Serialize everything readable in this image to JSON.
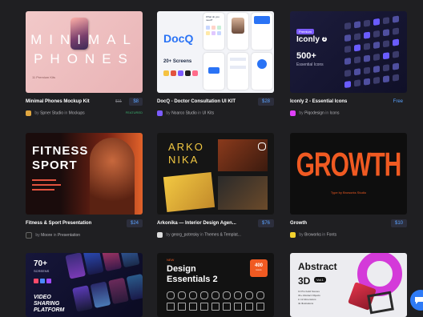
{
  "cards": [
    {
      "title": "Minimal Phones Mockup Kit",
      "old_price": "$11",
      "price": "$8",
      "author": "Spner Studio",
      "category": "Mockups",
      "badge": "FEATURED",
      "thumb": {
        "line1": "MINIMAL",
        "line2": "PHONES",
        "caption": "11 Premium Kits"
      },
      "avatar_color": "#e0a640"
    },
    {
      "title": "DocQ - Doctor Consultation UI KIT",
      "price": "$28",
      "author": "Noarco Studio",
      "category": "UI Kits",
      "thumb": {
        "brand": "DocQ",
        "screens": "20+ Screens",
        "headline": "What do you need?"
      },
      "avatar_color": "#7c5cff"
    },
    {
      "title": "Iconly 2 - Essential Icons",
      "price": "Free",
      "author": "Piqodesign",
      "category": "Icons",
      "thumb": {
        "tag": "Premium",
        "brand": "Iconly",
        "version": "2",
        "count": "500+",
        "sub": "Essential Icons"
      },
      "avatar_color": "#e040fb"
    },
    {
      "title": "Fitness & Sport Presentation",
      "price": "$24",
      "author": "Moore",
      "category": "Presentation",
      "thumb": {
        "line1": "FITNESS",
        "line2": "SPORT"
      },
      "avatar_color": "#222222"
    },
    {
      "title": "Arkonika — Interior Design Agen...",
      "price": "$76",
      "author": "georg_potresky",
      "category": "Themes & Templat...",
      "thumb": {
        "line1": "ARKO",
        "line2": "NIKA"
      },
      "avatar_color": "#dddddd"
    },
    {
      "title": "Growth",
      "price": "$10",
      "author": "Broworks",
      "category": "Fonts",
      "thumb": {
        "word": "GROWTH",
        "sub": "Type by Broworks Studio"
      },
      "avatar_color": "#f2d12e"
    },
    {
      "thumb": {
        "count": "70+",
        "screens": "SCREENS",
        "line1": "VIDEO",
        "line2": "SHARING",
        "line3": "PLATFORM"
      }
    },
    {
      "thumb": {
        "tag": "NEW",
        "line1": "Design",
        "line2": "Essentials 2",
        "badge_num": "400",
        "badge_sub": "icons"
      }
    },
    {
      "thumb": {
        "line1": "Abstract",
        "line2": "3D",
        "version": "Vol.1",
        "l1": "13 Pro build Scenes",
        "l2": "30+ Abstract Objects",
        "l3": "in 12 dimensions",
        "l4": "4k Illustrations"
      }
    }
  ],
  "by_label": "by",
  "in_label": "in",
  "colors": {
    "price": "#5aa2ff",
    "featured": "#3cb371",
    "chat": "#2f7bf6"
  }
}
